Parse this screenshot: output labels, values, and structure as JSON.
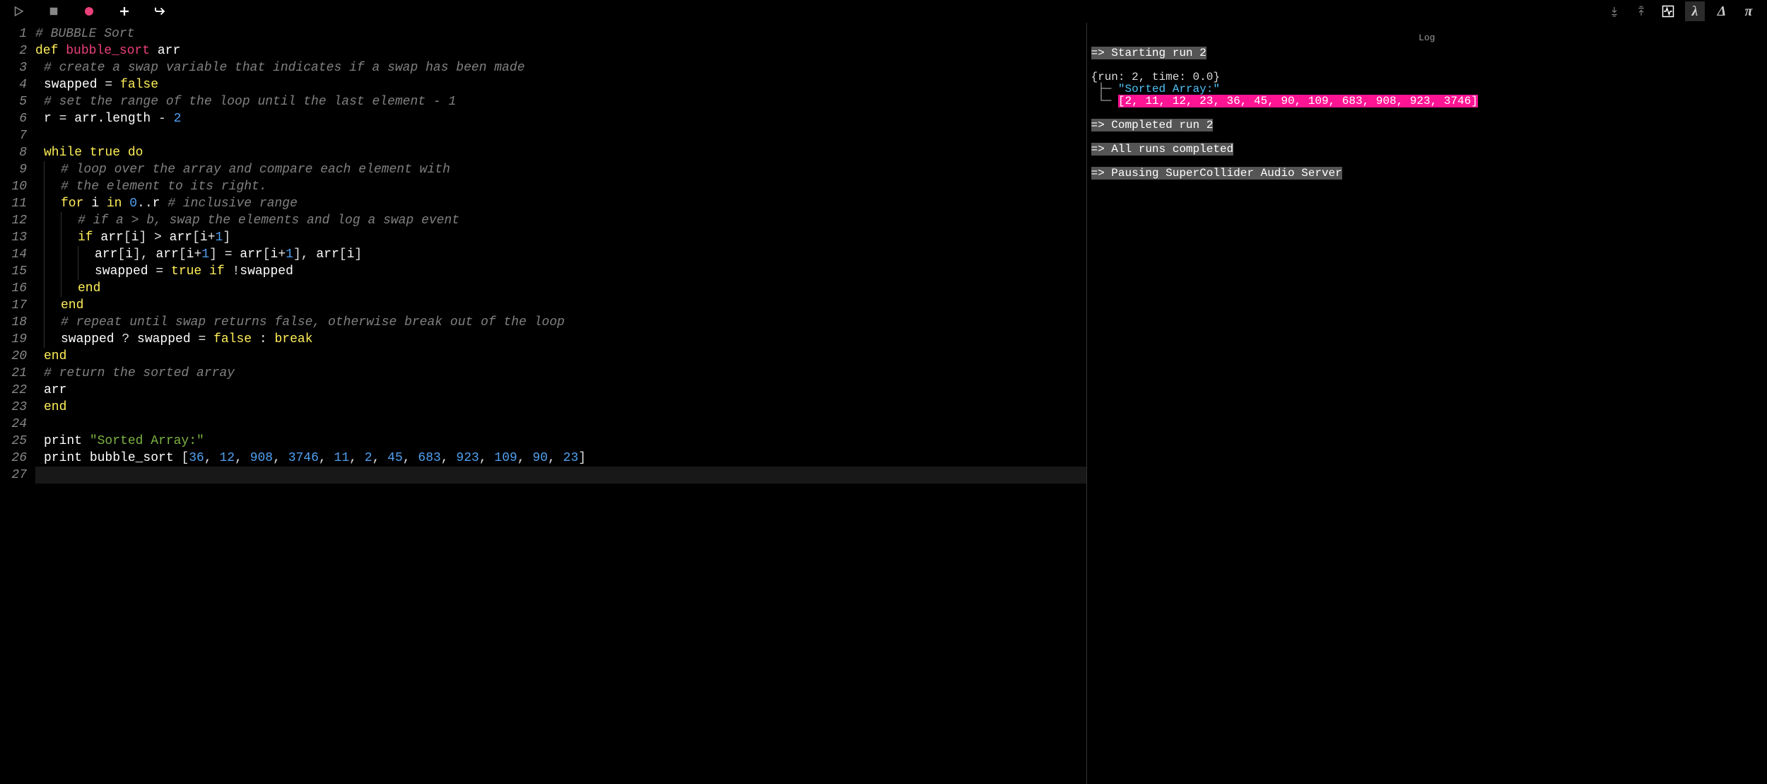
{
  "toolbar": {
    "left_icons": [
      "play-icon",
      "stop-icon",
      "record-icon",
      "add-icon",
      "reply-icon"
    ],
    "right_icons": [
      "arrows-down-icon",
      "arrows-up-icon",
      "activity-icon",
      "lambda-icon",
      "delta-icon",
      "pi-icon"
    ],
    "active_right": "lambda-icon"
  },
  "code": {
    "lines": [
      {
        "n": 1,
        "indent": 0,
        "guides": 0,
        "tokens": [
          {
            "t": "# BUBBLE Sort",
            "c": "comment"
          }
        ]
      },
      {
        "n": 2,
        "indent": 0,
        "guides": 0,
        "tokens": [
          {
            "t": "def ",
            "c": "kw"
          },
          {
            "t": "bubble_sort",
            "c": "funcname"
          },
          {
            "t": " arr",
            "c": "ident"
          }
        ]
      },
      {
        "n": 3,
        "indent": 1,
        "guides": 0,
        "tokens": [
          {
            "t": "# create a swap variable that indicates if a swap has been made",
            "c": "comment"
          }
        ]
      },
      {
        "n": 4,
        "indent": 1,
        "guides": 0,
        "tokens": [
          {
            "t": "swapped ",
            "c": "ident"
          },
          {
            "t": "= ",
            "c": "op"
          },
          {
            "t": "false",
            "c": "kw"
          }
        ]
      },
      {
        "n": 5,
        "indent": 1,
        "guides": 0,
        "tokens": [
          {
            "t": "# set the range of the loop until the last element - 1",
            "c": "comment"
          }
        ]
      },
      {
        "n": 6,
        "indent": 1,
        "guides": 0,
        "tokens": [
          {
            "t": "r ",
            "c": "ident"
          },
          {
            "t": "= ",
            "c": "op"
          },
          {
            "t": "arr",
            "c": "ident"
          },
          {
            "t": ".length ",
            "c": "ident"
          },
          {
            "t": "- ",
            "c": "op"
          },
          {
            "t": "2",
            "c": "num"
          }
        ]
      },
      {
        "n": 7,
        "indent": 1,
        "guides": 0,
        "tokens": []
      },
      {
        "n": 8,
        "indent": 1,
        "guides": 0,
        "tokens": [
          {
            "t": "while ",
            "c": "kw"
          },
          {
            "t": "true ",
            "c": "kw"
          },
          {
            "t": "do",
            "c": "kw"
          }
        ]
      },
      {
        "n": 9,
        "indent": 2,
        "guides": 1,
        "tokens": [
          {
            "t": "# loop over the array and compare each element with",
            "c": "comment"
          }
        ]
      },
      {
        "n": 10,
        "indent": 2,
        "guides": 1,
        "tokens": [
          {
            "t": "# the element to its right.",
            "c": "comment"
          }
        ]
      },
      {
        "n": 11,
        "indent": 2,
        "guides": 1,
        "tokens": [
          {
            "t": "for ",
            "c": "kw"
          },
          {
            "t": "i ",
            "c": "ident"
          },
          {
            "t": "in ",
            "c": "kw"
          },
          {
            "t": "0",
            "c": "num"
          },
          {
            "t": "..",
            "c": "op"
          },
          {
            "t": "r ",
            "c": "ident"
          },
          {
            "t": "# inclusive range",
            "c": "comment"
          }
        ]
      },
      {
        "n": 12,
        "indent": 3,
        "guides": 2,
        "tokens": [
          {
            "t": "# if a > b, swap the elements and log a swap event",
            "c": "comment"
          }
        ]
      },
      {
        "n": 13,
        "indent": 3,
        "guides": 2,
        "tokens": [
          {
            "t": "if ",
            "c": "kw"
          },
          {
            "t": "arr",
            "c": "ident"
          },
          {
            "t": "[",
            "c": "op"
          },
          {
            "t": "i",
            "c": "ident"
          },
          {
            "t": "] ",
            "c": "op"
          },
          {
            "t": "> ",
            "c": "op"
          },
          {
            "t": "arr",
            "c": "ident"
          },
          {
            "t": "[",
            "c": "op"
          },
          {
            "t": "i",
            "c": "ident"
          },
          {
            "t": "+",
            "c": "op"
          },
          {
            "t": "1",
            "c": "num"
          },
          {
            "t": "]",
            "c": "op"
          }
        ]
      },
      {
        "n": 14,
        "indent": 4,
        "guides": 3,
        "tokens": [
          {
            "t": "arr",
            "c": "ident"
          },
          {
            "t": "[",
            "c": "op"
          },
          {
            "t": "i",
            "c": "ident"
          },
          {
            "t": "], ",
            "c": "op"
          },
          {
            "t": "arr",
            "c": "ident"
          },
          {
            "t": "[",
            "c": "op"
          },
          {
            "t": "i",
            "c": "ident"
          },
          {
            "t": "+",
            "c": "op"
          },
          {
            "t": "1",
            "c": "num"
          },
          {
            "t": "] ",
            "c": "op"
          },
          {
            "t": "= ",
            "c": "op"
          },
          {
            "t": "arr",
            "c": "ident"
          },
          {
            "t": "[",
            "c": "op"
          },
          {
            "t": "i",
            "c": "ident"
          },
          {
            "t": "+",
            "c": "op"
          },
          {
            "t": "1",
            "c": "num"
          },
          {
            "t": "], ",
            "c": "op"
          },
          {
            "t": "arr",
            "c": "ident"
          },
          {
            "t": "[",
            "c": "op"
          },
          {
            "t": "i",
            "c": "ident"
          },
          {
            "t": "]",
            "c": "op"
          }
        ]
      },
      {
        "n": 15,
        "indent": 4,
        "guides": 3,
        "tokens": [
          {
            "t": "swapped ",
            "c": "ident"
          },
          {
            "t": "= ",
            "c": "op"
          },
          {
            "t": "true ",
            "c": "kw"
          },
          {
            "t": "if ",
            "c": "kw"
          },
          {
            "t": "!",
            "c": "op"
          },
          {
            "t": "swapped",
            "c": "ident"
          }
        ]
      },
      {
        "n": 16,
        "indent": 3,
        "guides": 2,
        "tokens": [
          {
            "t": "end",
            "c": "kw"
          }
        ]
      },
      {
        "n": 17,
        "indent": 2,
        "guides": 1,
        "tokens": [
          {
            "t": "end",
            "c": "kw"
          }
        ]
      },
      {
        "n": 18,
        "indent": 2,
        "guides": 1,
        "tokens": [
          {
            "t": "# repeat until swap returns false, otherwise break out of the loop",
            "c": "comment"
          }
        ]
      },
      {
        "n": 19,
        "indent": 2,
        "guides": 1,
        "tokens": [
          {
            "t": "swapped ",
            "c": "ident"
          },
          {
            "t": "? ",
            "c": "op"
          },
          {
            "t": "swapped ",
            "c": "ident"
          },
          {
            "t": "= ",
            "c": "op"
          },
          {
            "t": "false ",
            "c": "kw"
          },
          {
            "t": ": ",
            "c": "op"
          },
          {
            "t": "break",
            "c": "kw"
          }
        ]
      },
      {
        "n": 20,
        "indent": 1,
        "guides": 0,
        "tokens": [
          {
            "t": "end",
            "c": "kw"
          }
        ]
      },
      {
        "n": 21,
        "indent": 1,
        "guides": 0,
        "tokens": [
          {
            "t": "# return the sorted array",
            "c": "comment"
          }
        ]
      },
      {
        "n": 22,
        "indent": 1,
        "guides": 0,
        "tokens": [
          {
            "t": "arr",
            "c": "ident"
          }
        ]
      },
      {
        "n": 23,
        "indent": 1,
        "guides": 0,
        "tokens": [
          {
            "t": "end",
            "c": "kw"
          }
        ]
      },
      {
        "n": 24,
        "indent": 1,
        "guides": 0,
        "tokens": []
      },
      {
        "n": 25,
        "indent": 1,
        "guides": 0,
        "tokens": [
          {
            "t": "print ",
            "c": "ident"
          },
          {
            "t": "\"Sorted Array:\"",
            "c": "str"
          }
        ]
      },
      {
        "n": 26,
        "indent": 1,
        "guides": 0,
        "tokens": [
          {
            "t": "print ",
            "c": "ident"
          },
          {
            "t": "bubble_sort ",
            "c": "ident"
          },
          {
            "t": "[",
            "c": "op"
          },
          {
            "t": "36",
            "c": "num"
          },
          {
            "t": ", ",
            "c": "op"
          },
          {
            "t": "12",
            "c": "num"
          },
          {
            "t": ", ",
            "c": "op"
          },
          {
            "t": "908",
            "c": "num"
          },
          {
            "t": ", ",
            "c": "op"
          },
          {
            "t": "3746",
            "c": "num"
          },
          {
            "t": ", ",
            "c": "op"
          },
          {
            "t": "11",
            "c": "num"
          },
          {
            "t": ", ",
            "c": "op"
          },
          {
            "t": "2",
            "c": "num"
          },
          {
            "t": ", ",
            "c": "op"
          },
          {
            "t": "45",
            "c": "num"
          },
          {
            "t": ", ",
            "c": "op"
          },
          {
            "t": "683",
            "c": "num"
          },
          {
            "t": ", ",
            "c": "op"
          },
          {
            "t": "923",
            "c": "num"
          },
          {
            "t": ", ",
            "c": "op"
          },
          {
            "t": "109",
            "c": "num"
          },
          {
            "t": ", ",
            "c": "op"
          },
          {
            "t": "90",
            "c": "num"
          },
          {
            "t": ", ",
            "c": "op"
          },
          {
            "t": "23",
            "c": "num"
          },
          {
            "t": "]",
            "c": "op"
          }
        ]
      },
      {
        "n": 27,
        "indent": 0,
        "guides": 0,
        "tokens": [],
        "current": true
      }
    ]
  },
  "log": {
    "header": "Log",
    "lines": [
      {
        "segments": [
          {
            "t": "=> Starting run 2",
            "c": "hl-gray"
          }
        ]
      },
      {
        "segments": []
      },
      {
        "segments": [
          {
            "t": "{run: 2, time: 0.0}",
            "c": "log-plain"
          }
        ]
      },
      {
        "segments": [
          {
            "t": " ├─ ",
            "c": "tree-char"
          },
          {
            "t": "\"Sorted Array:\"",
            "c": "log-blue"
          }
        ]
      },
      {
        "segments": [
          {
            "t": " └─ ",
            "c": "tree-char"
          },
          {
            "t": "[2, 11, 12, 23, 36, 45, 90, 109, 683, 908, 923, 3746]",
            "c": "hl-pink"
          }
        ]
      },
      {
        "segments": []
      },
      {
        "segments": [
          {
            "t": "=> Completed run 2",
            "c": "hl-gray"
          }
        ]
      },
      {
        "segments": []
      },
      {
        "segments": [
          {
            "t": "=> All runs completed",
            "c": "hl-gray"
          }
        ]
      },
      {
        "segments": []
      },
      {
        "segments": [
          {
            "t": "=> Pausing SuperCollider Audio Server",
            "c": "hl-gray"
          }
        ]
      }
    ]
  }
}
